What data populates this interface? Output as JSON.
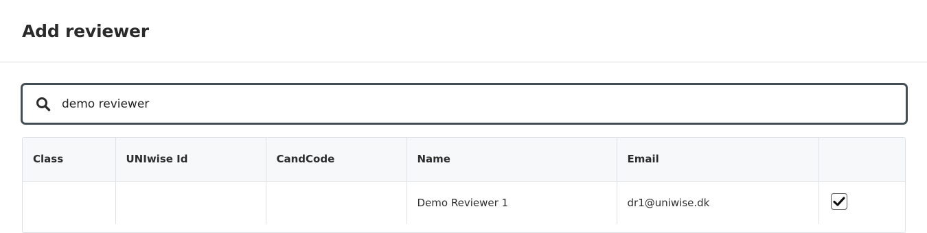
{
  "dialog": {
    "title": "Add reviewer"
  },
  "search": {
    "value": "demo reviewer",
    "icon": "search-icon"
  },
  "table": {
    "columns": [
      "Class",
      "UNIwise Id",
      "CandCode",
      "Name",
      "Email",
      ""
    ],
    "rows": [
      {
        "class": "",
        "uniwise_id": "",
        "candcode": "",
        "name": "Demo Reviewer 1",
        "email": "dr1@uniwise.dk",
        "selected": true
      }
    ]
  },
  "colors": {
    "search_border": "#434d55",
    "table_header_bg": "#f7f8f9",
    "border": "#dee1e4"
  }
}
